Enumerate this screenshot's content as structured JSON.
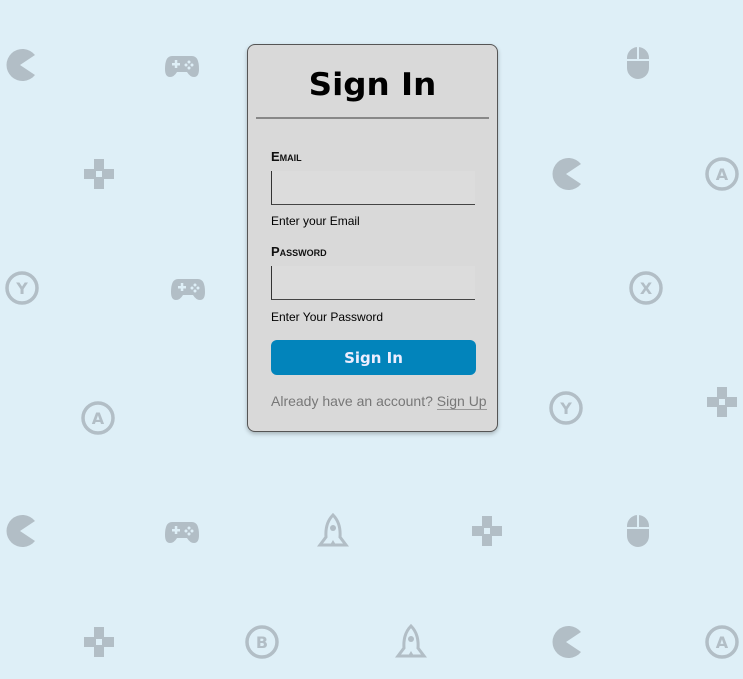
{
  "colors": {
    "background": "#deeff7",
    "card": "#d9d9d9",
    "accent": "#0284bb",
    "icon": "#b2bec6"
  },
  "background_icons": [
    "pacman-icon",
    "gamepad-icon",
    "mouse-icon",
    "dpad-icon",
    "pacman-icon",
    "a-button-icon",
    "y-button-icon",
    "gamepad-icon",
    "x-button-icon",
    "a-button-icon",
    "y-button-icon",
    "dpad-icon",
    "pacman-icon",
    "gamepad-icon",
    "rocket-icon",
    "dpad-icon",
    "mouse-icon",
    "dpad-icon",
    "b-button-icon",
    "rocket-icon",
    "pacman-icon",
    "a-button-icon"
  ],
  "form": {
    "title": "Sign In",
    "email_label": "Email",
    "email_value": "",
    "email_hint": "Enter your Email",
    "password_label": "Password",
    "password_value": "",
    "password_hint": "Enter Your Password",
    "submit_label": "Sign In",
    "footer_text": "Already have an account?",
    "signup_link": "Sign Up"
  }
}
